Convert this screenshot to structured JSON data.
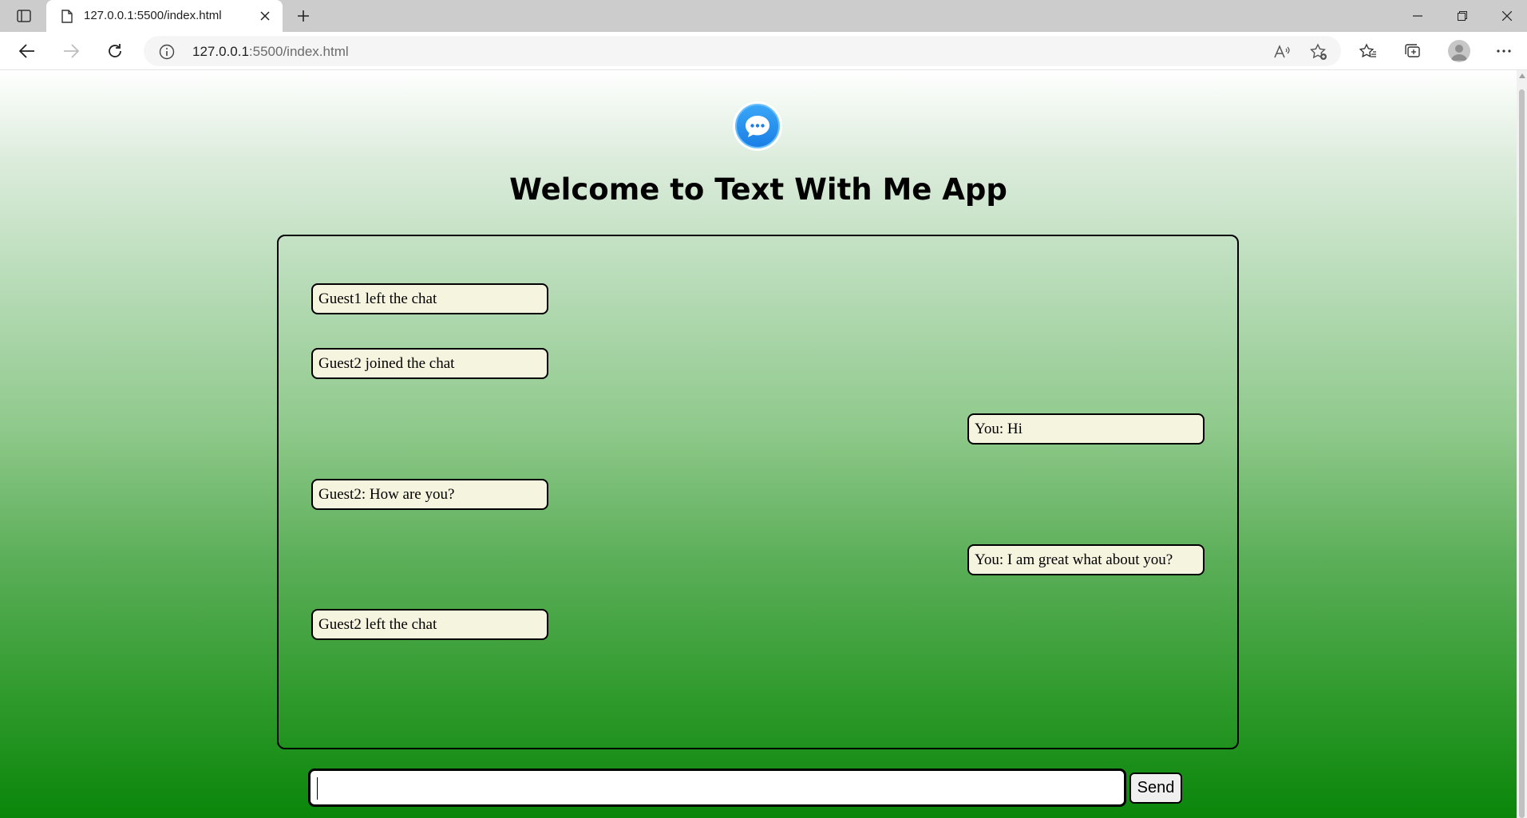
{
  "browser": {
    "tab_title": "127.0.0.1:5500/index.html",
    "url_host": "127.0.0.1",
    "url_path": ":5500/index.html"
  },
  "app": {
    "title": "Welcome to Text With Me App",
    "logo_icon": "chat-bubble-icon",
    "accent_color": "#1a7fe6"
  },
  "messages": [
    {
      "text": "Guest1 left the chat",
      "side": "left"
    },
    {
      "text": "Guest2 joined the chat",
      "side": "left"
    },
    {
      "text": "You: Hi",
      "side": "right"
    },
    {
      "text": "Guest2: How are you?",
      "side": "left"
    },
    {
      "text": "You: I am great what about you?",
      "side": "right"
    },
    {
      "text": "Guest2 left the chat",
      "side": "left"
    }
  ],
  "composer": {
    "input_value": "",
    "send_label": "Send"
  }
}
